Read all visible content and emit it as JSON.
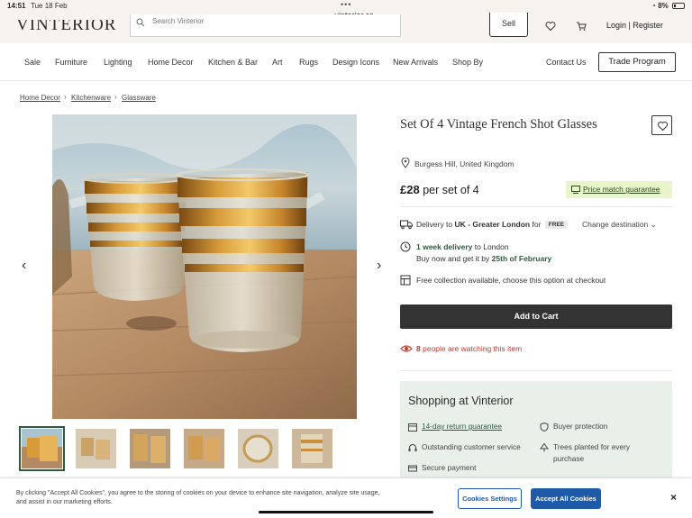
{
  "status": {
    "time": "14:51",
    "date": "Tue 18 Feb",
    "battery": "8%",
    "url": "vinterior.co"
  },
  "header": {
    "logo": "VINTERIOR",
    "search_placeholder": "Search Vinterior",
    "sell_label": "Sell",
    "login_label": "Login | Register"
  },
  "nav": {
    "items": [
      "Sale",
      "Furniture",
      "Lighting",
      "Home Decor",
      "Kitchen & Bar",
      "Art",
      "Rugs",
      "Design Icons",
      "New Arrivals",
      "Shop By"
    ],
    "contact": "Contact Us",
    "trade": "Trade Program"
  },
  "breadcrumb": [
    "Home Decor",
    "Kitchenware",
    "Glassware"
  ],
  "product": {
    "title": "Set Of 4 Vintage French Shot Glasses",
    "location": "Burgess Hill, United Kingdom",
    "price": "£28",
    "price_unit": "per set of 4",
    "price_match": "Price match guarantee",
    "delivery_prefix": "Delivery to",
    "delivery_dest": "UK - Greater London",
    "delivery_for": "for",
    "delivery_free": "FREE",
    "change_destination": "Change destination",
    "delivery_time": "1 week delivery",
    "delivery_to": "to London",
    "buy_now": "Buy now and get it by",
    "buy_date": "25th of February",
    "collection": "Free collection available, choose this option at checkout",
    "add_to_cart": "Add to Cart",
    "watching_count": "8",
    "watching_text": "people are watching this item"
  },
  "shopping": {
    "title": "Shopping at Vinterior",
    "return": "14-day return guarantee",
    "protection": "Buyer protection",
    "service": "Outstanding customer service",
    "trees": "Trees planted for every purchase",
    "payment": "Secure payment"
  },
  "cookie": {
    "text": "By clicking \"Accept All Cookies\", you agree to the storing of cookies on your device to enhance site navigation, analyze site usage, and assist in our marketing efforts.",
    "settings": "Cookies Settings",
    "accept": "Accept All Cookies",
    "close": "×"
  },
  "colors": {
    "accent_green": "#2f5a3c",
    "cart_bg": "#333333",
    "price_match_bg": "#e8f5c8",
    "cookie_blue": "#1f5aa8",
    "watch_red": "#c0392b",
    "shop_bg": "#e9f0ea"
  }
}
